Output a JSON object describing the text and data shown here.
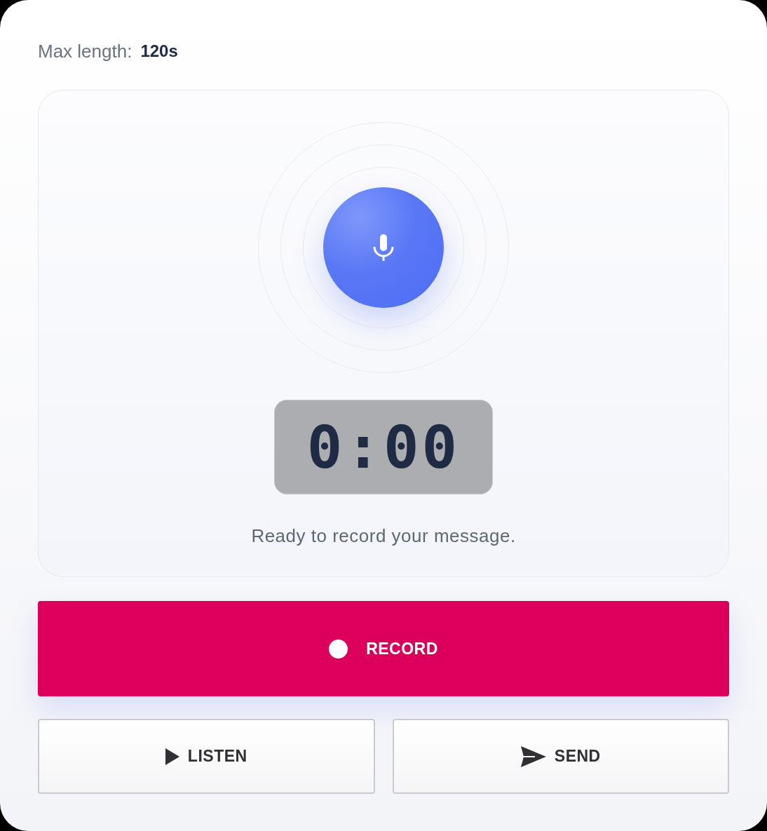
{
  "max_length": {
    "label": "Max length:",
    "value": "120s"
  },
  "recorder": {
    "timer": "0:00",
    "status": "Ready to record your message."
  },
  "record_button": {
    "label": "RECORD",
    "kind": "record"
  },
  "actions": [
    {
      "label": "LISTEN",
      "kind": "listen"
    },
    {
      "label": "SEND",
      "kind": "send"
    }
  ]
}
